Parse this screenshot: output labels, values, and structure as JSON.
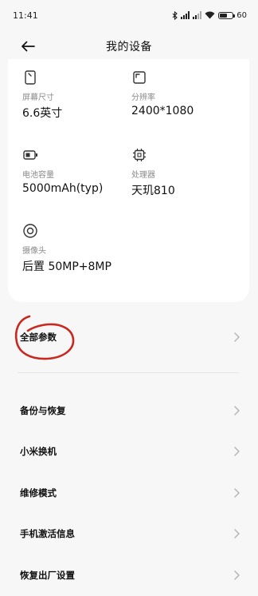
{
  "status_bar": {
    "time": "11:41",
    "battery_text": "60",
    "battery_level": 0.6,
    "icons": [
      "bluetooth-icon",
      "signal-icon",
      "signal-icon",
      "wifi-icon",
      "battery-icon"
    ]
  },
  "header": {
    "title": "我的设备",
    "back_icon": "back-arrow-icon"
  },
  "specs": [
    {
      "icon": "screen-size-icon",
      "label": "屏幕尺寸",
      "value": "6.6英寸"
    },
    {
      "icon": "resolution-icon",
      "label": "分辨率",
      "value": "2400*1080"
    },
    {
      "icon": "battery-capacity-icon",
      "label": "电池容量",
      "value": "5000mAh(typ)"
    },
    {
      "icon": "processor-icon",
      "label": "处理器",
      "value": "天玑810"
    },
    {
      "icon": "camera-icon",
      "label": "摄像头",
      "value": "后置 50MP+8MP"
    }
  ],
  "menu": {
    "all_params": "全部参数",
    "items": [
      {
        "label": "备份与恢复"
      },
      {
        "label": "小米换机"
      },
      {
        "label": "维修模式"
      },
      {
        "label": "手机激活信息"
      },
      {
        "label": "恢复出厂设置"
      }
    ]
  },
  "colors": {
    "background": "#f7f7f7",
    "card": "#ffffff",
    "annotation": "#c8281e",
    "label_gray": "#8a8a8a"
  }
}
